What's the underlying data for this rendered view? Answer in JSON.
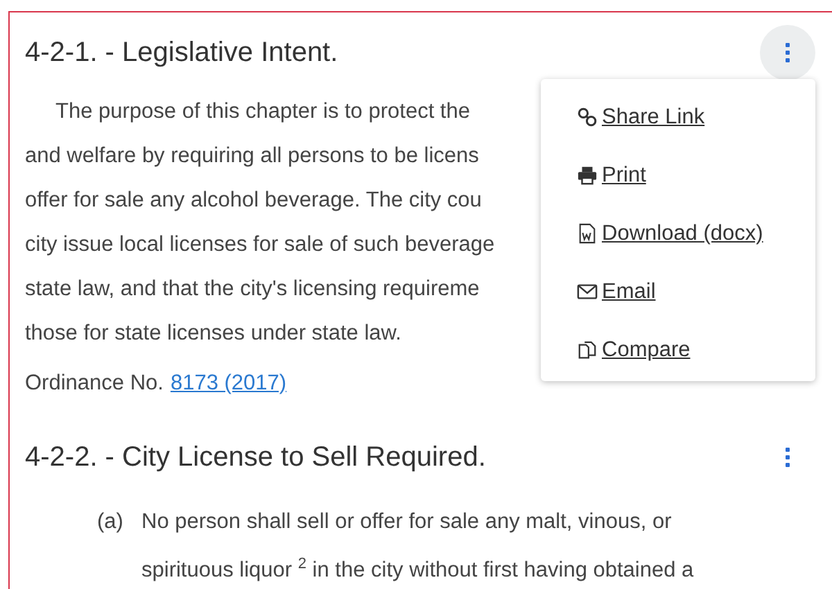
{
  "sections": [
    {
      "heading": "4-2-1. - Legislative Intent.",
      "menu_open": true,
      "paragraph_lines": [
        "The purpose of this chapter is to protect the",
        "and welfare by requiring all persons to be licens",
        "offer for sale any alcohol beverage. The city cou",
        "city issue local licenses for sale of such beverage",
        "state law, and that the city's licensing requireme",
        "those for state licenses under state law."
      ],
      "ordinance": {
        "label": "Ordinance No.",
        "link": "8173 (2017)"
      },
      "menu": [
        {
          "kind": "link",
          "label": "Share Link"
        },
        {
          "kind": "print",
          "label": "Print"
        },
        {
          "kind": "docx",
          "label": "Download (docx)"
        },
        {
          "kind": "email",
          "label": "Email"
        },
        {
          "kind": "compare",
          "label": "Compare"
        }
      ]
    },
    {
      "heading": "4-2-2. - City License to Sell Required.",
      "menu_open": false,
      "items": [
        {
          "marker": "(a)",
          "lines": [
            "No person shall sell or offer for sale any malt, vinous, or",
            "spirituous liquor $^{2}$ in the city without first having obtained a"
          ]
        }
      ]
    }
  ]
}
